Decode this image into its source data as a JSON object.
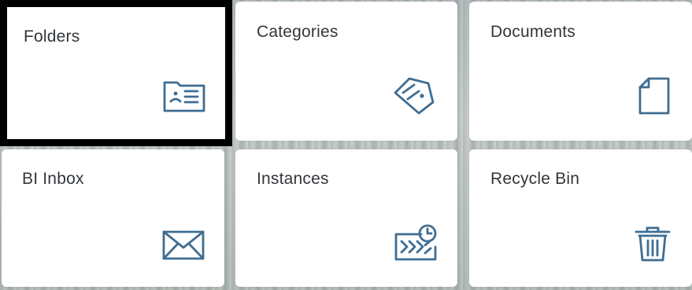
{
  "icon_color": "#3f6d92",
  "tiles": [
    {
      "label": "Folders",
      "icon": "folder-icon",
      "focused": true
    },
    {
      "label": "Categories",
      "icon": "tag-icon",
      "focused": false
    },
    {
      "label": "Documents",
      "icon": "document-icon",
      "focused": false
    },
    {
      "label": "BI Inbox",
      "icon": "envelope-icon",
      "focused": false
    },
    {
      "label": "Instances",
      "icon": "scheduled-instances-icon",
      "focused": false
    },
    {
      "label": "Recycle Bin",
      "icon": "trash-icon",
      "focused": false
    }
  ]
}
